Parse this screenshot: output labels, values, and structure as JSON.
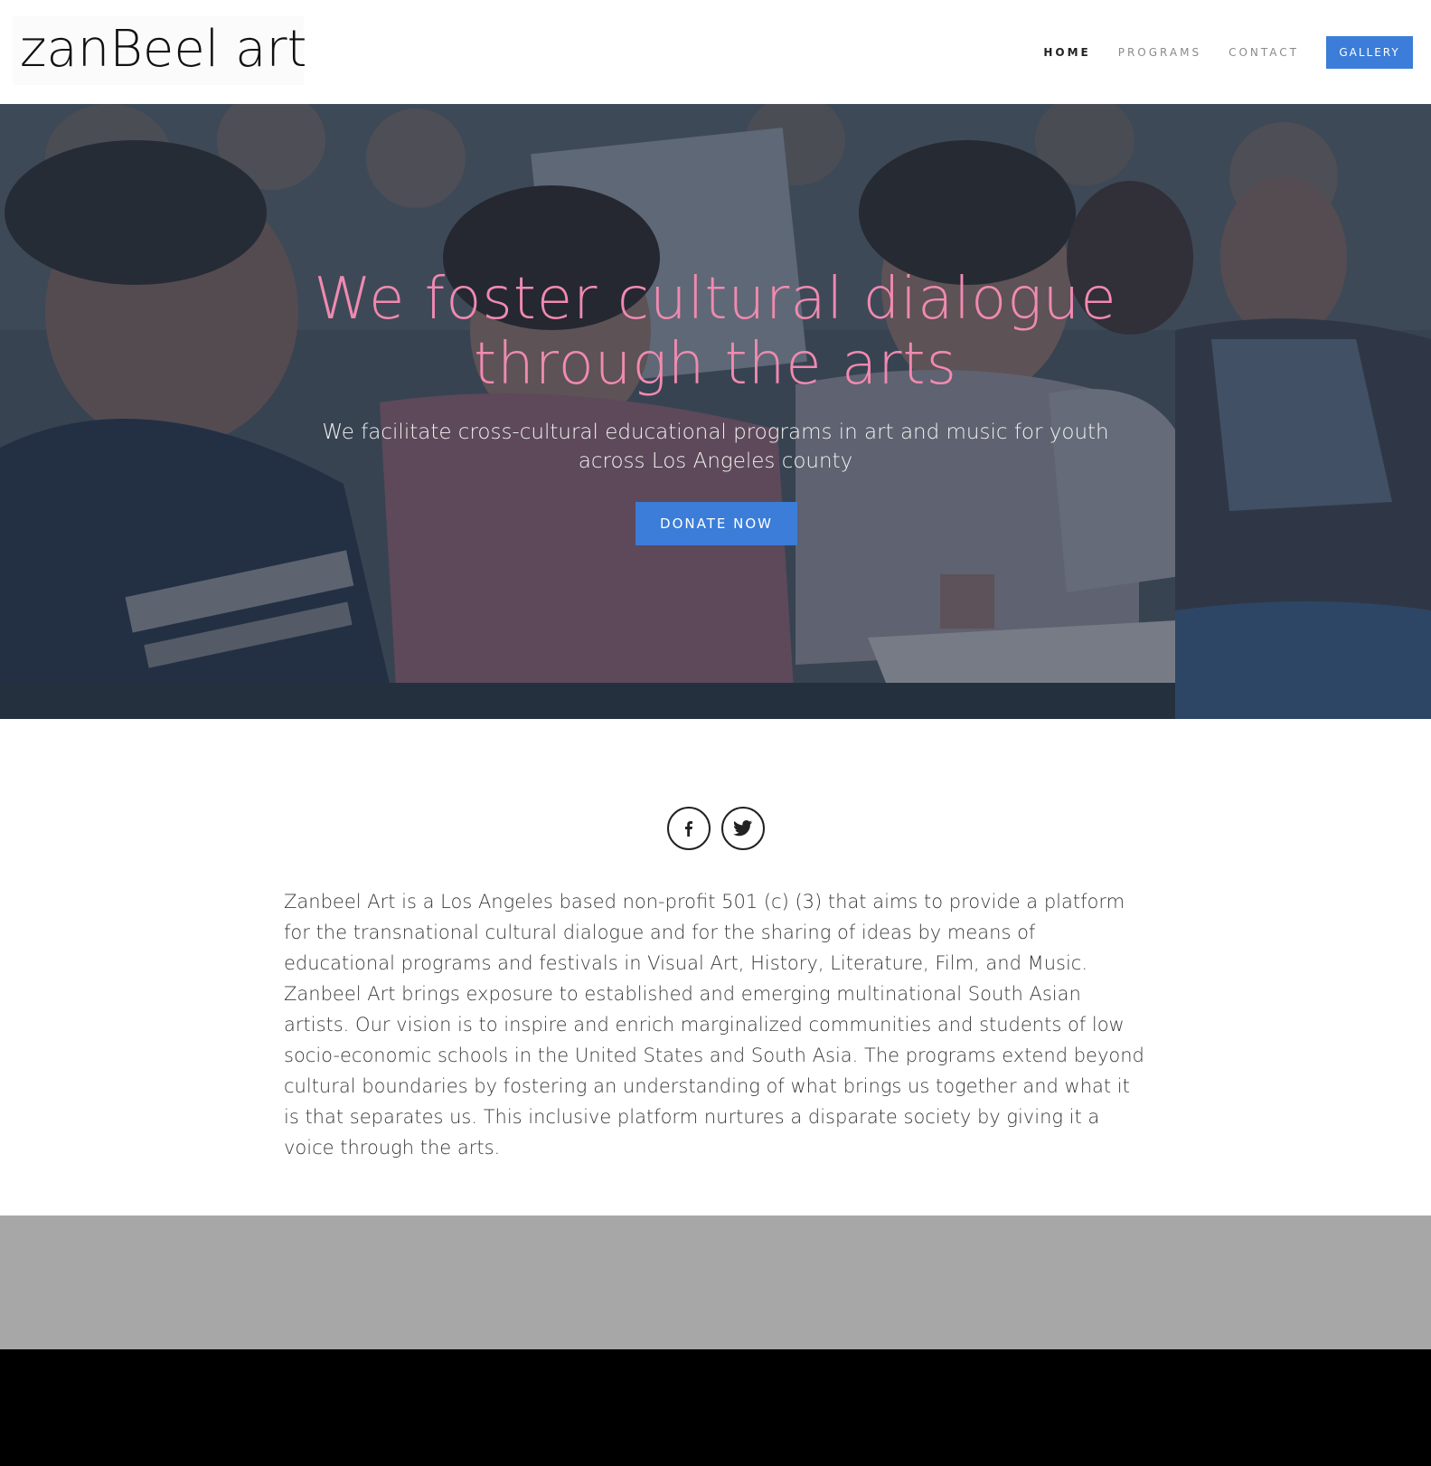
{
  "header": {
    "logo_text": "zanBeel art",
    "nav": {
      "home": "HOME",
      "programs": "PROGRAMS",
      "contact": "CONTACT",
      "gallery": "GALLERY"
    }
  },
  "hero": {
    "title": "We foster cultural dialogue through the arts",
    "subtitle": "We facilitate cross-cultural educational programs in art and music for youth across Los Angeles county",
    "donate_label": "DONATE NOW"
  },
  "social": {
    "icons": [
      "facebook-icon",
      "twitter-icon"
    ]
  },
  "about": {
    "text": "Zanbeel Art is a Los Angeles based non-profit 501 (c) (3) that aims to provide a platform for the transnational cultural dialogue and for the sharing of ideas by means of educational programs and festivals in Visual Art, History, Literature, Film, and Music. Zanbeel Art brings exposure to established and emerging multinational South Asian artists. Our vision is to inspire and enrich marginalized communities and students of low socio-economic schools in the United States and South Asia. The programs extend beyond cultural boundaries by fostering an understanding of what brings us together and what it is that separates us. This inclusive platform nurtures a disparate society by giving it a voice through the arts."
  },
  "colors": {
    "accent": "#3b7dd8",
    "hero_title": "#f08ab0",
    "gray_band": "#a7a7a7",
    "black_band": "#000000"
  }
}
